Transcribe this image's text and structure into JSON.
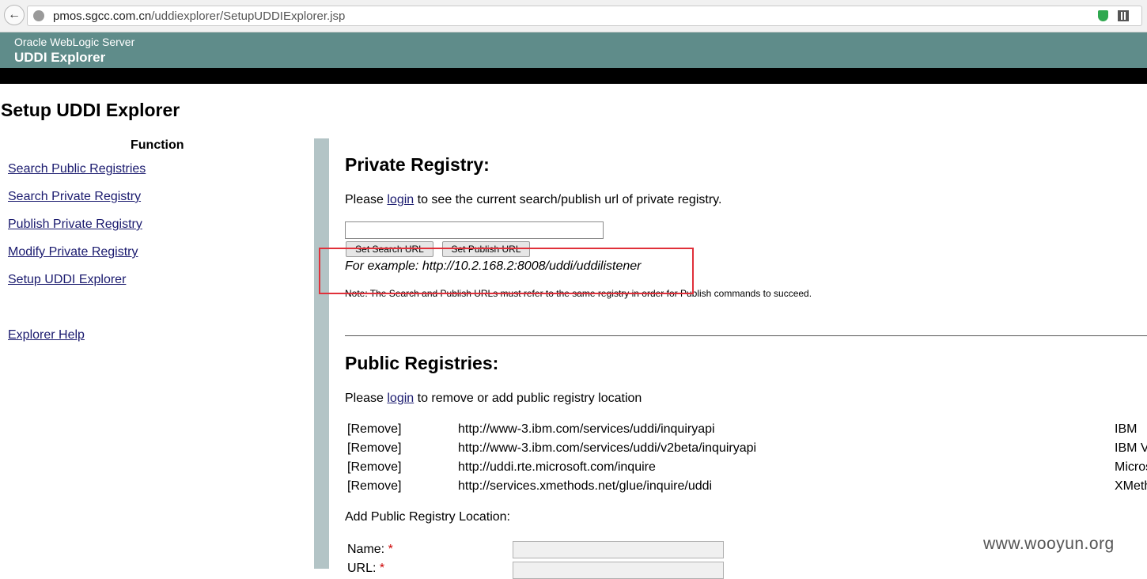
{
  "browser": {
    "url_host": "pmos.sgcc.com.cn",
    "url_path": "/uddiexplorer/SetupUDDIExplorer.jsp"
  },
  "banner": {
    "subtitle": "Oracle WebLogic Server",
    "title": "UDDI Explorer"
  },
  "page_title": "Setup UDDI Explorer",
  "sidebar": {
    "heading": "Function",
    "items": [
      {
        "label": "Search Public Registries"
      },
      {
        "label": "Search Private Registry"
      },
      {
        "label": "Publish Private Registry"
      },
      {
        "label": "Modify Private Registry"
      },
      {
        "label": "Setup UDDI Explorer"
      }
    ],
    "help": "Explorer Help"
  },
  "private": {
    "heading": "Private Registry:",
    "msg_pre": "Please ",
    "login": "login",
    "msg_post": " to see the current search/publish url of private registry.",
    "input_value": "",
    "set_search": "Set Search URL",
    "set_publish": "Set Publish URL",
    "example": "For example: http://10.2.168.2:8008/uddi/uddilistener",
    "note": "Note: The Search and Publish URLs must refer to the same registry in order for Publish commands to succeed."
  },
  "public": {
    "heading": "Public Registries:",
    "msg_pre": "Please ",
    "login": "login",
    "msg_post": " to remove or add public registry location",
    "rows": [
      {
        "action": "[Remove]",
        "url": "http://www-3.ibm.com/services/uddi/inquiryapi",
        "name": "IBM"
      },
      {
        "action": "[Remove]",
        "url": "http://www-3.ibm.com/services/uddi/v2beta/inquiryapi",
        "name": "IBM V"
      },
      {
        "action": "[Remove]",
        "url": "http://uddi.rte.microsoft.com/inquire",
        "name": "Micros"
      },
      {
        "action": "[Remove]",
        "url": "http://services.xmethods.net/glue/inquire/uddi",
        "name": "XMeth"
      }
    ],
    "add_heading": "Add Public Registry Location:",
    "name_label": "Name:",
    "url_label": "URL:",
    "required_mark": "*"
  },
  "watermark": "www.wooyun.org"
}
